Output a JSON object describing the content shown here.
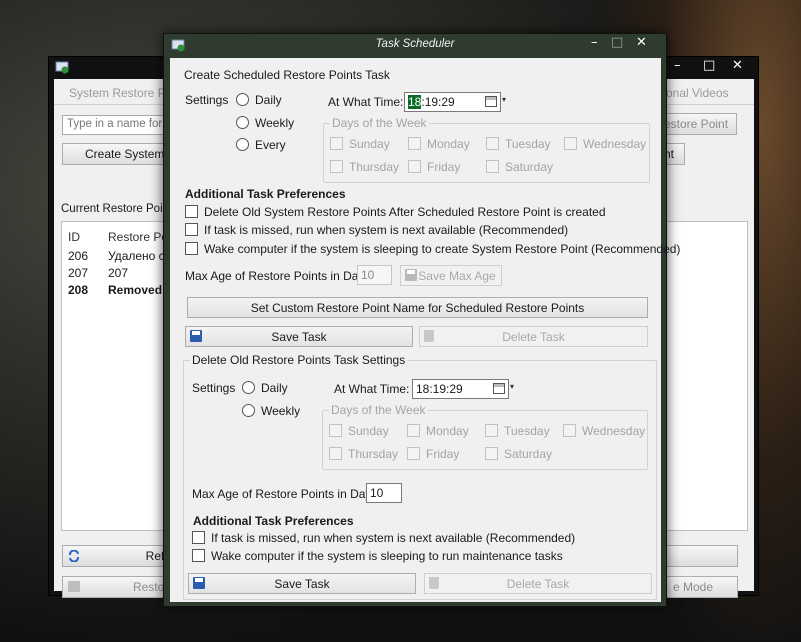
{
  "background_window": {
    "tabs": [
      "System Restore Po",
      "onal Videos"
    ],
    "name_input_placeholder": "Type in a name for yo",
    "create_button": "Create System R",
    "restore_point_button": "estore Point",
    "nt_button": "nt",
    "list_label": "Current Restore Point",
    "columns": [
      "ID",
      "Restore Poi"
    ],
    "rows": [
      {
        "id": "206",
        "name": "Удалено с"
      },
      {
        "id": "207",
        "name": "207"
      },
      {
        "id": "208",
        "name": "Removed"
      }
    ],
    "refresh_button": "Refre",
    "restore_button": "Restore",
    "mode_button": "e Mode"
  },
  "dialog": {
    "title": "Task Scheduler",
    "create_section": {
      "heading": "Create Scheduled Restore Points Task",
      "settings_label": "Settings",
      "options": [
        "Daily",
        "Weekly",
        "Every"
      ],
      "time_label": "At What Time:",
      "time_hour": "18",
      "time_rest": ":19:29",
      "days_group_title": "Days of the Week",
      "days": [
        "Sunday",
        "Monday",
        "Tuesday",
        "Wednesday",
        "Thursday",
        "Friday",
        "Saturday"
      ],
      "prefs_heading": "Additional Task Preferences",
      "prefs": [
        "Delete Old System Restore Points After Scheduled Restore Point is created",
        "If task is missed, run when system is next available (Recommended)",
        "Wake computer if the system is sleeping to create System Restore Point (Recommended)"
      ],
      "max_age_label": "Max Age of Restore Points in Days:",
      "max_age_value": "10",
      "save_max_age": "Save Max Age",
      "custom_name_button": "Set Custom Restore Point Name for Scheduled Restore Points",
      "save_task": "Save Task",
      "delete_task": "Delete Task"
    },
    "delete_section": {
      "group_title": "Delete Old Restore Points Task Settings",
      "settings_label": "Settings",
      "options": [
        "Daily",
        "Weekly"
      ],
      "time_label": "At What Time:",
      "time_value": "18:19:29",
      "days_group_title": "Days of the Week",
      "days": [
        "Sunday",
        "Monday",
        "Tuesday",
        "Wednesday",
        "Thursday",
        "Friday",
        "Saturday"
      ],
      "max_age_label": "Max Age of Restore Points in Days:",
      "max_age_value": "10",
      "prefs_heading": "Additional Task Preferences",
      "prefs": [
        "If task is missed, run when system is next available (Recommended)",
        "Wake computer if the system is sleeping to run maintenance tasks"
      ],
      "save_task": "Save Task",
      "delete_task": "Delete Task"
    }
  },
  "colors": {
    "dialog_frame": "#2e3b2e",
    "time_highlight": "#0b6b28",
    "client_bg": "#f0f0f0"
  }
}
